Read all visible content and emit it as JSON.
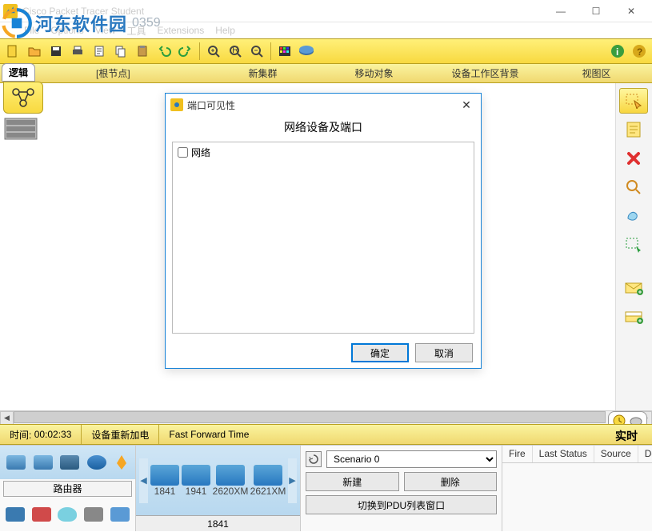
{
  "window": {
    "title": "Cisco Packet Tracer Student"
  },
  "watermark": {
    "text": "河东软件园",
    "phone": "0359"
  },
  "menu": {
    "file": "File",
    "options": "Options",
    "view": "View",
    "tools": "工具",
    "extensions": "Extensions",
    "help": "Help"
  },
  "yellowbar": {
    "logic": "逻辑",
    "root": "[根节点]",
    "new_cluster": "新集群",
    "move_obj": "移动对象",
    "workspace_bg": "设备工作区背景",
    "viewport": "视图区"
  },
  "dialog": {
    "title": "端口可见性",
    "heading": "网络设备及端口",
    "checkbox_label": "网络",
    "ok": "确定",
    "cancel": "取消"
  },
  "timebar": {
    "time_label": "时间:",
    "time_value": "00:02:33",
    "power_cycle": "设备重新加电",
    "fast_forward": "Fast Forward Time",
    "realtime": "实时"
  },
  "devcat": {
    "selected_name": "路由器"
  },
  "devlist": {
    "items": [
      "1841",
      "1941",
      "2620XM",
      "2621XM"
    ],
    "status": "1841"
  },
  "scenario": {
    "selected": "Scenario 0",
    "new": "新建",
    "delete": "删除",
    "toggle_pdu": "切换到PDU列表窗口"
  },
  "table": {
    "headers": [
      "Fire",
      "Last Status",
      "Source",
      "Destination"
    ]
  },
  "icons": {
    "select": "select-icon",
    "note": "note-icon",
    "delete": "delete-icon",
    "zoom": "zoom-icon",
    "shape": "shape-icon",
    "resize": "resize-icon",
    "env_simple": "envelope-simple-icon",
    "env_complex": "envelope-complex-icon"
  }
}
